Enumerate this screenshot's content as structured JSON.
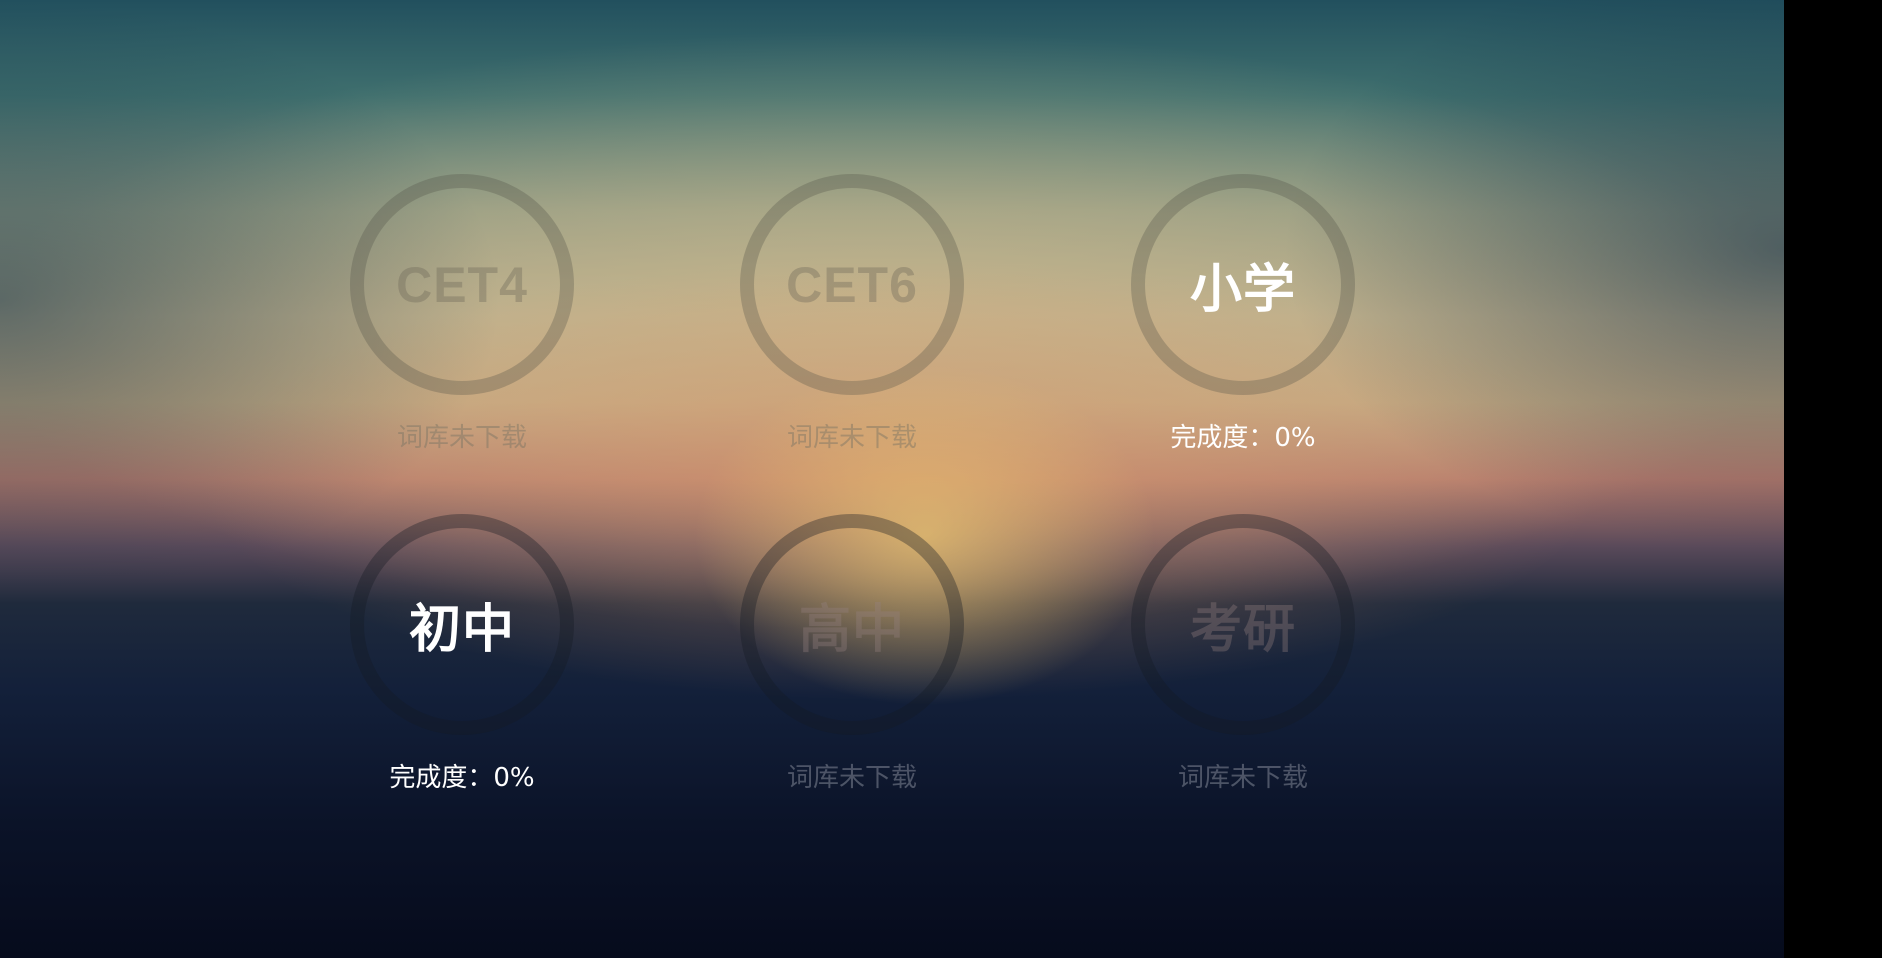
{
  "books": [
    {
      "label": "CET4",
      "status": "词库未下载",
      "active": false
    },
    {
      "label": "CET6",
      "status": "词库未下载",
      "active": false
    },
    {
      "label": "小学",
      "status": "完成度：0%",
      "active": true
    },
    {
      "label": "初中",
      "status": "完成度：0%",
      "active": true
    },
    {
      "label": "高中",
      "status": "词库未下载",
      "active": false
    },
    {
      "label": "考研",
      "status": "词库未下载",
      "active": false
    }
  ]
}
